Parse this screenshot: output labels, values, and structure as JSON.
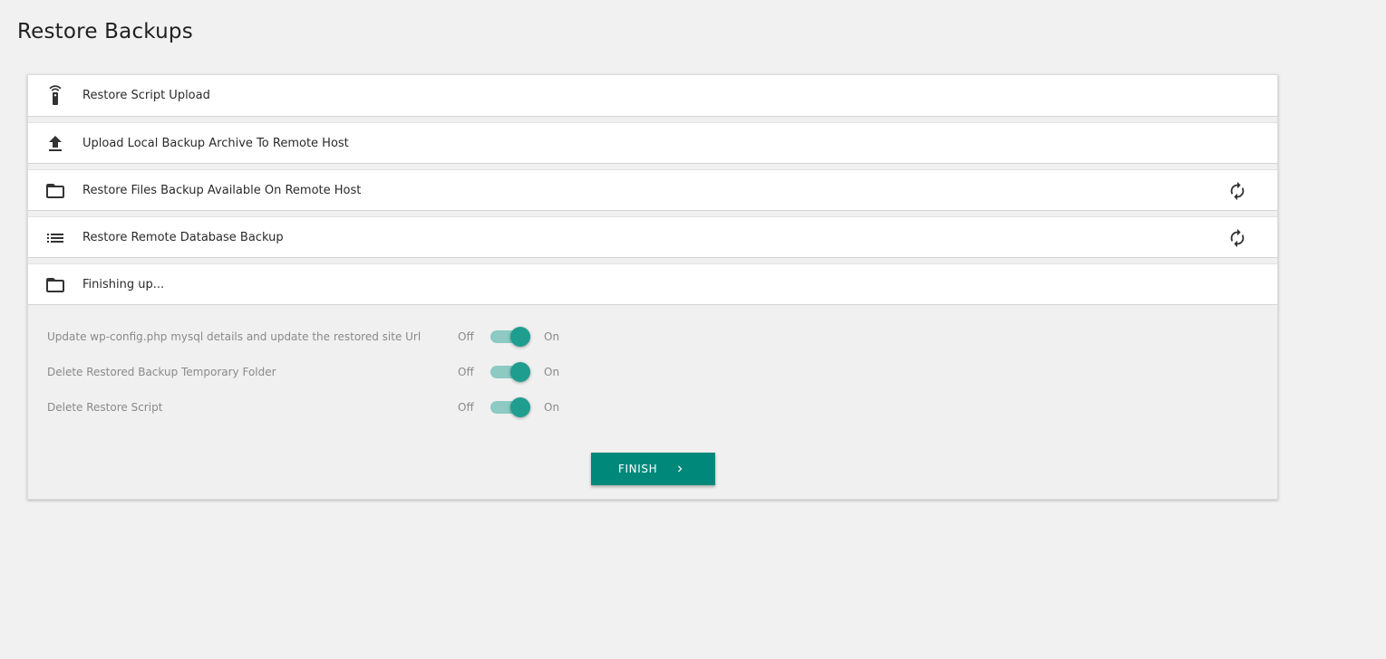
{
  "page": {
    "title": "Restore Backups"
  },
  "steps": [
    {
      "label": "Restore Script Upload",
      "icon": "remote-signal-icon",
      "refresh": false
    },
    {
      "label": "Upload Local Backup Archive To Remote Host",
      "icon": "upload-icon",
      "refresh": false
    },
    {
      "label": "Restore Files Backup Available On Remote Host",
      "icon": "folder-icon",
      "refresh": true
    },
    {
      "label": "Restore Remote Database Backup",
      "icon": "list-icon",
      "refresh": true
    },
    {
      "label": "Finishing up...",
      "icon": "folder-icon",
      "refresh": false
    }
  ],
  "finishing": {
    "options": [
      {
        "label": "Update wp-config.php mysql details and update the restored site Url",
        "off_label": "Off",
        "on_label": "On",
        "enabled": true
      },
      {
        "label": "Delete Restored Backup Temporary Folder",
        "off_label": "Off",
        "on_label": "On",
        "enabled": true
      },
      {
        "label": "Delete Restore Script",
        "off_label": "Off",
        "on_label": "On",
        "enabled": true
      }
    ],
    "finish_button": {
      "label": "FINISH",
      "icon": "chevron-right-icon"
    }
  },
  "colors": {
    "accent": "#00897b",
    "switch_thumb": "#1f9e90",
    "switch_track": "#8ccac3",
    "background": "#f1f1f1"
  }
}
